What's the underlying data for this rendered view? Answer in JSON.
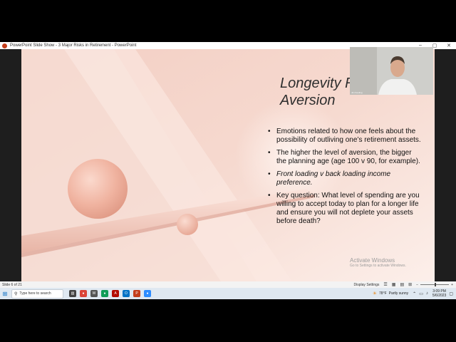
{
  "window": {
    "title": "PowerPoint Slide Show  -  3 Major Risks in Retirement - PowerPoint",
    "controls": {
      "minimize": "–",
      "restore": "▢",
      "close": "✕"
    }
  },
  "slide": {
    "title": "Longevity Risk\nAversion",
    "bullets": [
      {
        "text": "Emotions related to how one feels about the possibility of outliving one’s retirement assets.",
        "italic": false
      },
      {
        "text": "The higher the level of aversion, the bigger the planning age (age 100 v 90, for example).",
        "italic": false
      },
      {
        "text": "Front loading v back loading income preference.",
        "italic": true
      },
      {
        "text": "Key question: What level of spending are you willing to accept today to plan for a longer life and ensure you will not deplete your assets before death?",
        "italic": false
      }
    ]
  },
  "webcam": {
    "name": "Jim Keuling"
  },
  "watermark": {
    "heading": "Activate Windows",
    "sub": "Go to Settings to activate Windows."
  },
  "statusbar": {
    "slide_info": "Slide 6 of 21",
    "display_settings": "Display Settings",
    "views": [
      "☰",
      "▦",
      "▤",
      "⊞"
    ]
  },
  "taskbar": {
    "search_placeholder": "Type here to search",
    "apps": [
      {
        "name": "task-view",
        "color": "#444444",
        "glyph": "▥"
      },
      {
        "name": "chrome",
        "color": "#db4437",
        "glyph": "●"
      },
      {
        "name": "wl",
        "color": "#555555",
        "glyph": "W"
      },
      {
        "name": "chrome-2",
        "color": "#0f9d58",
        "glyph": "●"
      },
      {
        "name": "acrobat",
        "color": "#b30b00",
        "glyph": "A"
      },
      {
        "name": "outlook",
        "color": "#0072c6",
        "glyph": "O"
      },
      {
        "name": "powerpoint",
        "color": "#c43e1c",
        "glyph": "P"
      },
      {
        "name": "zoom",
        "color": "#2d8cff",
        "glyph": "●"
      }
    ],
    "weather_temp": "78°F",
    "weather_text": "Partly sunny",
    "time": "3:09 PM",
    "date": "5/6/2023"
  }
}
